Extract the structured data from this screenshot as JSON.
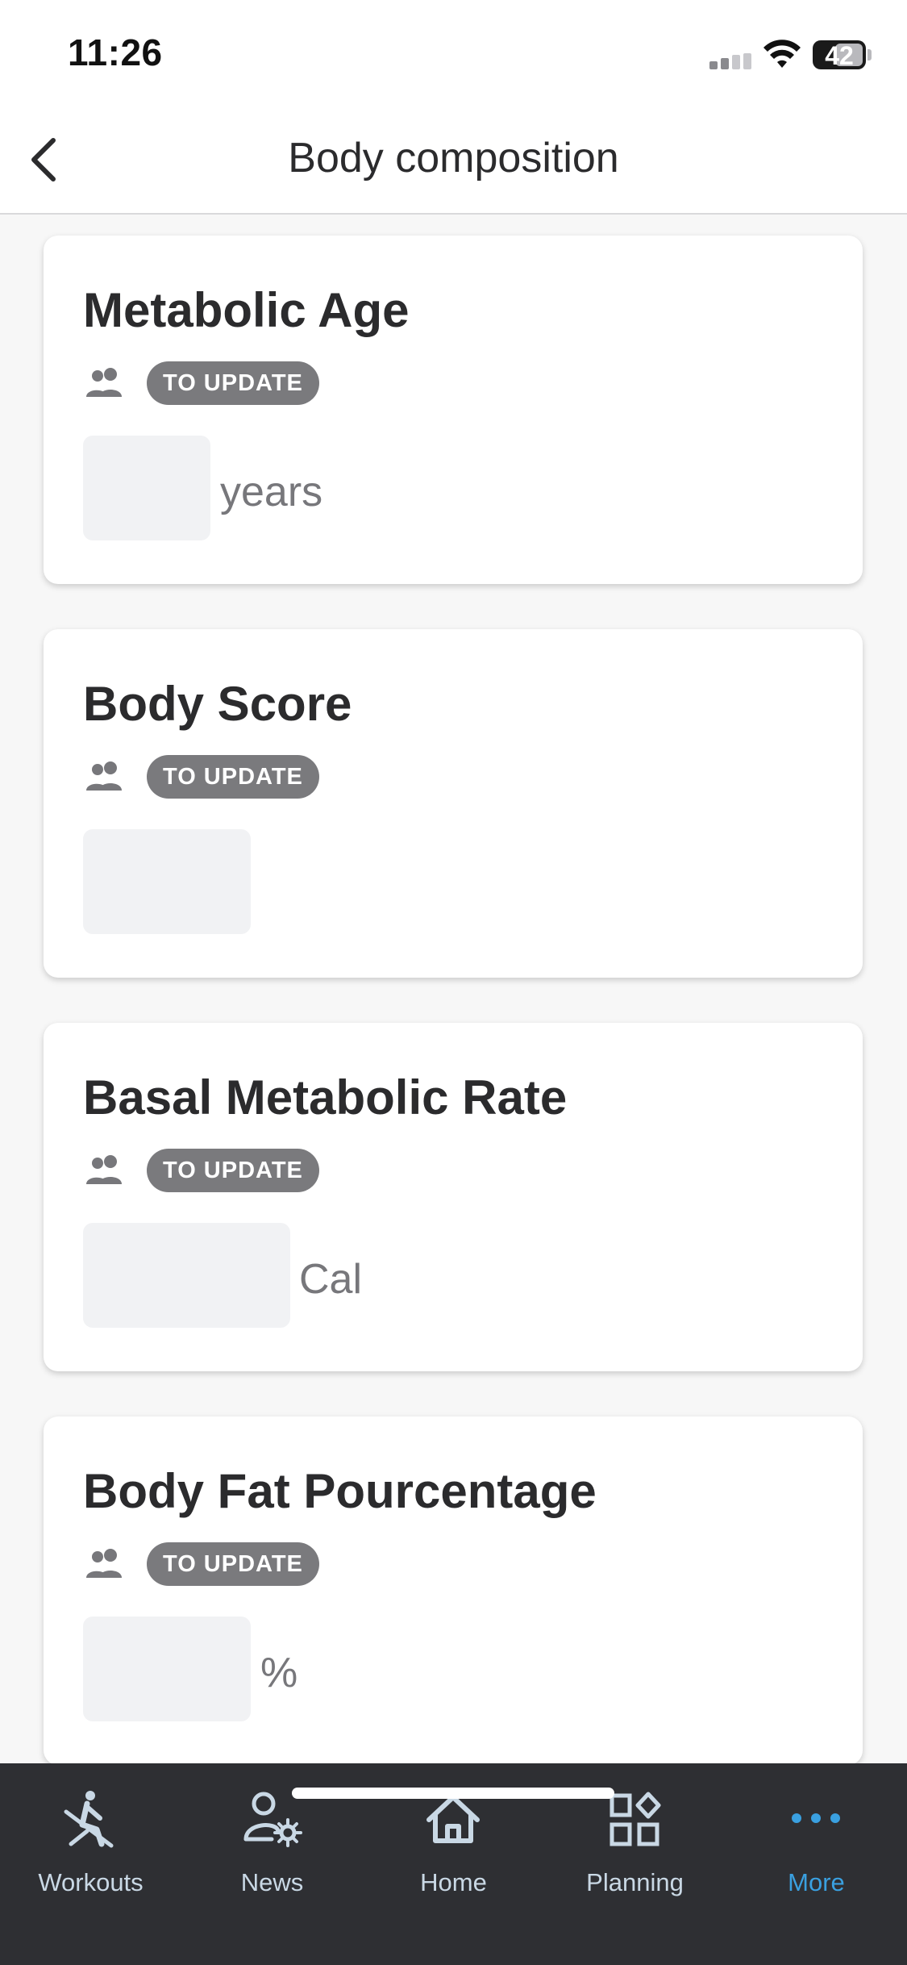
{
  "status_bar": {
    "time": "11:26",
    "battery": "42",
    "icons": [
      "cellular-signal-icon",
      "wifi-icon",
      "battery-icon"
    ]
  },
  "header": {
    "title": "Body composition",
    "back_icon": "chevron-left-icon"
  },
  "cards": [
    {
      "title": "Metabolic Age",
      "badge": "TO UPDATE",
      "unit": "years",
      "icon": "people-icon"
    },
    {
      "title": "Body Score",
      "badge": "TO UPDATE",
      "unit": "",
      "icon": "people-icon"
    },
    {
      "title": "Basal Metabolic Rate",
      "badge": "TO UPDATE",
      "unit": "Cal",
      "icon": "people-icon"
    },
    {
      "title": "Body Fat Pourcentage",
      "badge": "TO UPDATE",
      "unit": "%",
      "icon": "people-icon"
    }
  ],
  "tab_bar": {
    "active": "More",
    "tabs": [
      {
        "label": "Workouts",
        "icon": "rowing-icon"
      },
      {
        "label": "News",
        "icon": "user-settings-icon"
      },
      {
        "label": "Home",
        "icon": "home-icon"
      },
      {
        "label": "Planning",
        "icon": "grid-shapes-icon"
      },
      {
        "label": "More",
        "icon": "more-dots-icon"
      }
    ]
  },
  "colors": {
    "background": "#f7f7f7",
    "badge": "#7a7a7d",
    "tab_bar": "#2e2f33",
    "tab_active": "#3aa0e0",
    "placeholder_box": "#f1f2f4"
  }
}
